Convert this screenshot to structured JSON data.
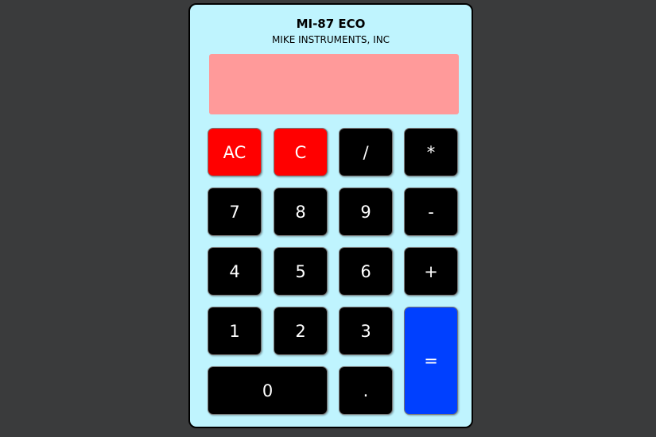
{
  "header": {
    "title": "MI-87 ECO",
    "subtitle": "MIKE INSTRUMENTS, INC"
  },
  "display": {
    "value": ""
  },
  "keys": {
    "all_clear": "AC",
    "clear": "C",
    "divide": "/",
    "multiply": "*",
    "seven": "7",
    "eight": "8",
    "nine": "9",
    "subtract": "-",
    "four": "4",
    "five": "5",
    "six": "6",
    "add": "+",
    "one": "1",
    "two": "2",
    "three": "3",
    "equals": "=",
    "zero": "0",
    "decimal": "."
  },
  "colors": {
    "background": "#3a3b3c",
    "body": "#bff4fe",
    "display": "#ff9a9a",
    "key_default": "#000000",
    "key_clear": "#ff0000",
    "key_equals": "#0040ff"
  }
}
